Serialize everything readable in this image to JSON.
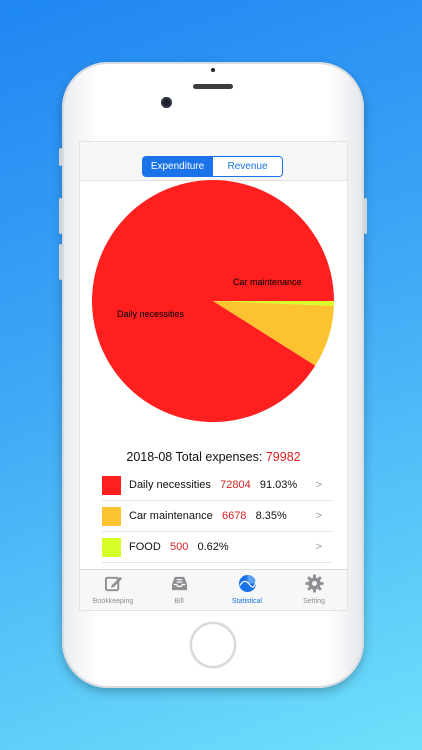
{
  "segment": {
    "expenditure": "Expenditure",
    "revenue": "Revenue",
    "selected": "Expenditure"
  },
  "summary": {
    "period": "2018-08",
    "label": "Total expenses:",
    "total": "79982"
  },
  "chart_data": {
    "type": "pie",
    "slices": [
      {
        "name": "Daily necessities",
        "value": 72804,
        "percent": "91.03%",
        "color": "#ff1f1f"
      },
      {
        "name": "Car maintenance",
        "value": 6678,
        "percent": "8.35%",
        "color": "#fdc22f"
      },
      {
        "name": "FOOD",
        "value": 500,
        "percent": "0.62%",
        "color": "#d6ff2a"
      }
    ]
  },
  "categories": [
    {
      "name": "Daily necessities",
      "amount": "72804",
      "percent": "91.03%",
      "color": "#ff1f1f",
      "chevron": ">"
    },
    {
      "name": "Car maintenance",
      "amount": "6678",
      "percent": "8.35%",
      "color": "#fdc22f",
      "chevron": ">"
    },
    {
      "name": "FOOD",
      "amount": "500",
      "percent": "0.62%",
      "color": "#d6ff2a",
      "chevron": ">"
    }
  ],
  "tabs": [
    {
      "label": "Bookkeeping",
      "icon": "pencil-icon"
    },
    {
      "label": "Bill",
      "icon": "inbox-icon"
    },
    {
      "label": "Statistical",
      "icon": "pie-chart-icon",
      "active": true
    },
    {
      "label": "Setting",
      "icon": "gear-icon"
    }
  ],
  "colors": {
    "accent": "#1a73e8",
    "amount": "#d32020",
    "total": "#e02020"
  }
}
